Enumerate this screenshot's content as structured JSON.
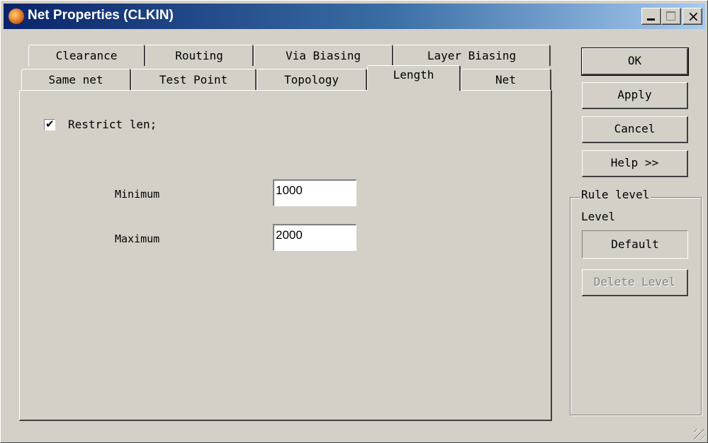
{
  "window": {
    "title": "Net Properties (CLKIN)",
    "icon": "app-flame-icon",
    "controls": {
      "minimize": "minimize-icon",
      "maximize": "maximize-icon",
      "close": "×"
    }
  },
  "tabs": {
    "row1": [
      "Clearance",
      "Routing",
      "Via Biasing",
      "Layer Biasing"
    ],
    "row2": [
      "Same net",
      "Test Point",
      "Topology",
      "Length",
      "Net"
    ],
    "active": "Length"
  },
  "length_panel": {
    "restrict_label": "Restrict len;",
    "restrict_checked": true,
    "checkmark": "✔",
    "minimum_label": "Minimum",
    "minimum_value": "1000",
    "maximum_label": "Maximum",
    "maximum_value": "2000"
  },
  "buttons": {
    "ok": "OK",
    "apply": "Apply",
    "cancel": "Cancel",
    "help": "Help >>"
  },
  "rule_level": {
    "group_label": "Rule level",
    "level_label": "Level",
    "level_value": "Default",
    "delete_label": "Delete Level"
  }
}
